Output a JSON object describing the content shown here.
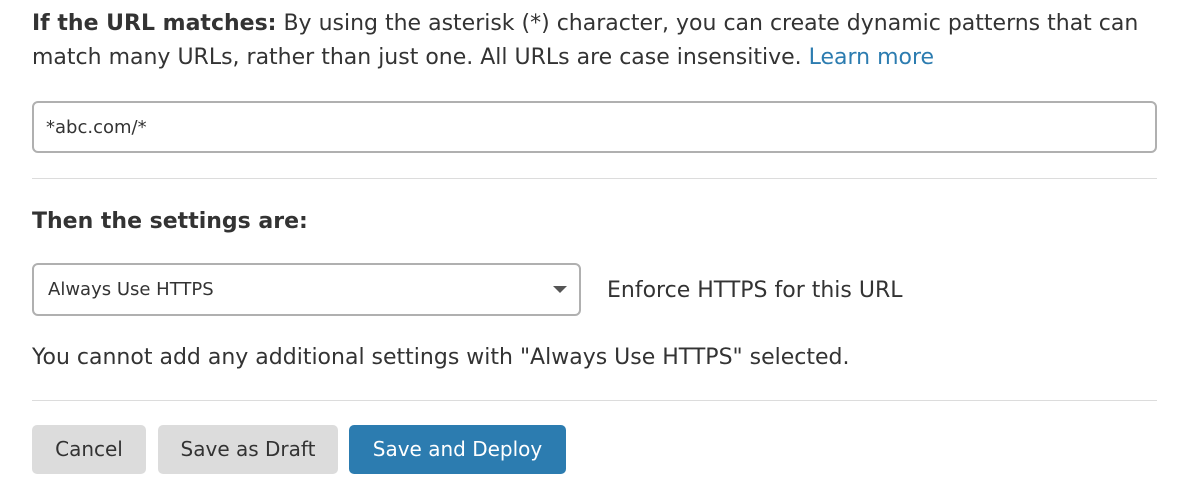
{
  "url_section": {
    "label": "If the URL matches:",
    "description": " By using the asterisk (*) character, you can create dynamic patterns that can match many URLs, rather than just one. All URLs are case insensitive. ",
    "learn_more": "Learn more",
    "input_value": "*abc.com/*"
  },
  "settings_section": {
    "heading": "Then the settings are:",
    "selected_setting": "Always Use HTTPS",
    "setting_description": "Enforce HTTPS for this URL",
    "note": "You cannot add any additional settings with \"Always Use HTTPS\" selected."
  },
  "actions": {
    "cancel_label": "Cancel",
    "draft_label": "Save as Draft",
    "deploy_label": "Save and Deploy"
  },
  "colors": {
    "link": "#2c7cb0",
    "primary_button": "#2c7cb0",
    "secondary_button": "#dcdcdc",
    "text": "#333333"
  }
}
